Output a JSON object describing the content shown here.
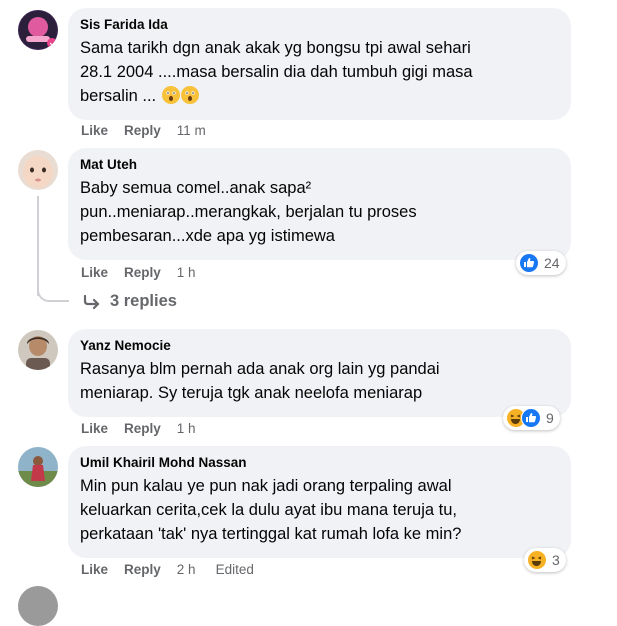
{
  "comments": [
    {
      "author": "Sis Farida Ida",
      "lines": [
        "Sama tarikh dgn anak akak yg bongsu tpi awal sehari",
        "28.1 2004 ....masa bersalin dia dah tumbuh gigi masa",
        "bersalin ..."
      ],
      "like": "Like",
      "reply": "Reply",
      "time": "11 m"
    },
    {
      "author": "Mat Uteh",
      "lines": [
        "Baby semua comel..anak sapa²",
        "pun..meniarap..merangkak, berjalan tu proses",
        "pembesaran...xde apa yg istimewa"
      ],
      "like": "Like",
      "reply": "Reply",
      "time": "1 h",
      "reaction_count": "24",
      "replies_label": "3 replies"
    },
    {
      "author": "Yanz Nemocie",
      "lines": [
        "Rasanya blm pernah ada anak org lain yg pandai",
        "meniarap. Sy teruja tgk anak neelofa meniarap"
      ],
      "like": "Like",
      "reply": "Reply",
      "time": "1 h",
      "reaction_count": "9"
    },
    {
      "author": "Umil Khairil Mohd Nassan",
      "lines": [
        "Min pun kalau ye pun nak jadi orang terpaling awal",
        "keluarkan cerita,cek la dulu ayat ibu mana teruja tu,",
        "perkataan 'tak' nya tertinggal kat rumah lofa ke min?"
      ],
      "like": "Like",
      "reply": "Reply",
      "time": "2 h",
      "edited": "Edited",
      "reaction_count": "3"
    }
  ],
  "colors": {
    "bubble": "#f0f2f5",
    "secondary_text": "#65676b",
    "like_blue": "#1877f2",
    "haha_yellow": "#f7b125"
  },
  "icons": {
    "reply_arrow": "reply-arrow-icon",
    "like": "like-reaction-icon",
    "haha": "haha-reaction-icon",
    "emoji": "astonished-face-emoji"
  }
}
